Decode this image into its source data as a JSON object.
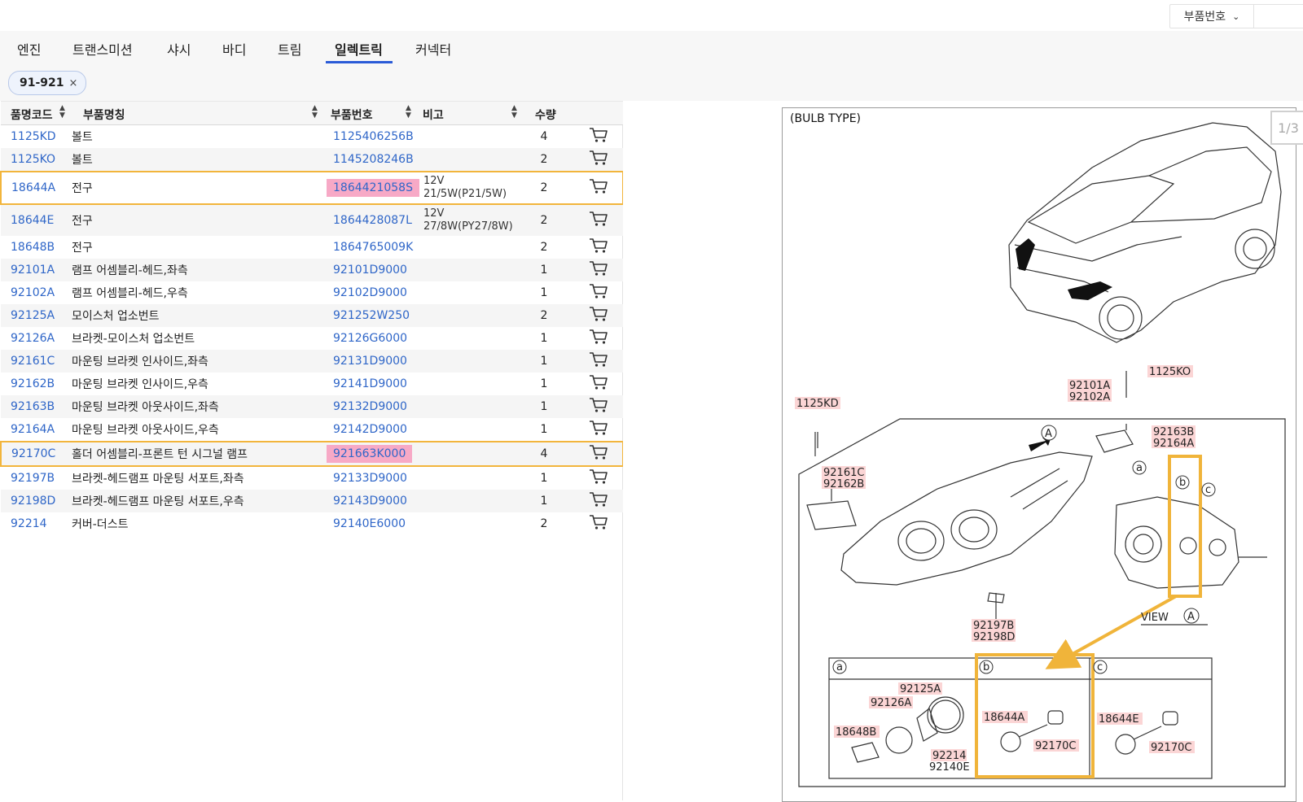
{
  "topbar": {
    "select_value": "부품번호"
  },
  "tabs": [
    "엔진",
    "트랜스미션",
    "샤시",
    "바디",
    "트림",
    "일렉트릭",
    "커넥터"
  ],
  "active_tab": "일렉트릭",
  "filter": {
    "chip_label": "91-921",
    "chip_close": "×"
  },
  "table": {
    "headers": {
      "code": "품명코드",
      "name": "부품명칭",
      "part_no": "부품번호",
      "note": "비고",
      "qty": "수량"
    },
    "rows": [
      {
        "code": "1125KD",
        "name": "볼트",
        "part_no": "1125406256B",
        "note_l1": "",
        "note_l2": "",
        "qty": "4"
      },
      {
        "code": "1125KO",
        "name": "볼트",
        "part_no": "1145208246B",
        "note_l1": "",
        "note_l2": "",
        "qty": "2"
      },
      {
        "code": "18644A",
        "name": "전구",
        "part_no": "1864421058S",
        "note_l1": "12V",
        "note_l2": "21/5W(P21/5W)",
        "qty": "2"
      },
      {
        "code": "18644E",
        "name": "전구",
        "part_no": "1864428087L",
        "note_l1": "12V",
        "note_l2": "27/8W(PY27/8W)",
        "qty": "2"
      },
      {
        "code": "18648B",
        "name": "전구",
        "part_no": "1864765009K",
        "note_l1": "",
        "note_l2": "",
        "qty": "2"
      },
      {
        "code": "92101A",
        "name": "램프 어셈블리-헤드,좌측",
        "part_no": "92101D9000",
        "note_l1": "",
        "note_l2": "",
        "qty": "1"
      },
      {
        "code": "92102A",
        "name": "램프 어셈블리-헤드,우측",
        "part_no": "92102D9000",
        "note_l1": "",
        "note_l2": "",
        "qty": "1"
      },
      {
        "code": "92125A",
        "name": "모이스처 업소번트",
        "part_no": "921252W250",
        "note_l1": "",
        "note_l2": "",
        "qty": "2"
      },
      {
        "code": "92126A",
        "name": "브라켓-모이스처 업소번트",
        "part_no": "92126G6000",
        "note_l1": "",
        "note_l2": "",
        "qty": "1"
      },
      {
        "code": "92161C",
        "name": "마운팅 브라켓 인사이드,좌측",
        "part_no": "92131D9000",
        "note_l1": "",
        "note_l2": "",
        "qty": "1"
      },
      {
        "code": "92162B",
        "name": "마운팅 브라켓 인사이드,우측",
        "part_no": "92141D9000",
        "note_l1": "",
        "note_l2": "",
        "qty": "1"
      },
      {
        "code": "92163B",
        "name": "마운팅 브라켓 아웃사이드,좌측",
        "part_no": "92132D9000",
        "note_l1": "",
        "note_l2": "",
        "qty": "1"
      },
      {
        "code": "92164A",
        "name": "마운팅 브라켓 아웃사이드,우측",
        "part_no": "92142D9000",
        "note_l1": "",
        "note_l2": "",
        "qty": "1"
      },
      {
        "code": "92170C",
        "name": "홀더 어셈블리-프론트 턴 시그널 램프",
        "part_no": "921663K000",
        "note_l1": "",
        "note_l2": "",
        "qty": "4"
      },
      {
        "code": "92197B",
        "name": "브라켓-헤드램프 마운팅 서포트,좌측",
        "part_no": "92133D9000",
        "note_l1": "",
        "note_l2": "",
        "qty": "1"
      },
      {
        "code": "92198D",
        "name": "브라켓-헤드램프 마운팅 서포트,우측",
        "part_no": "92143D9000",
        "note_l1": "",
        "note_l2": "",
        "qty": "1"
      },
      {
        "code": "92214",
        "name": "커버-더스트",
        "part_no": "92140E6000",
        "note_l1": "",
        "note_l2": "",
        "qty": "2"
      }
    ]
  },
  "diagram": {
    "title": "(BULB TYPE)",
    "pager": "1/3",
    "labels": {
      "l_1125KO": "1125KO",
      "l_1125KD": "1125KD",
      "l_92101A": "92101A",
      "l_92102A": "92102A",
      "l_92163B": "92163B",
      "l_92164A": "92164A",
      "l_92161C": "92161C",
      "l_92162B": "92162B",
      "l_92197B": "92197B",
      "l_92198D": "92198D",
      "l_A": "A",
      "l_a": "a",
      "l_b": "b",
      "l_c": "c",
      "l_view": "VIEW",
      "l_92125A": "92125A",
      "l_92126A": "92126A",
      "l_18648B": "18648B",
      "l_92214": "92214",
      "l_92140E": "92140E",
      "l_18644A": "18644A",
      "l_92170C_b": "92170C",
      "l_18644E": "18644E",
      "l_92170C_c": "92170C"
    }
  }
}
